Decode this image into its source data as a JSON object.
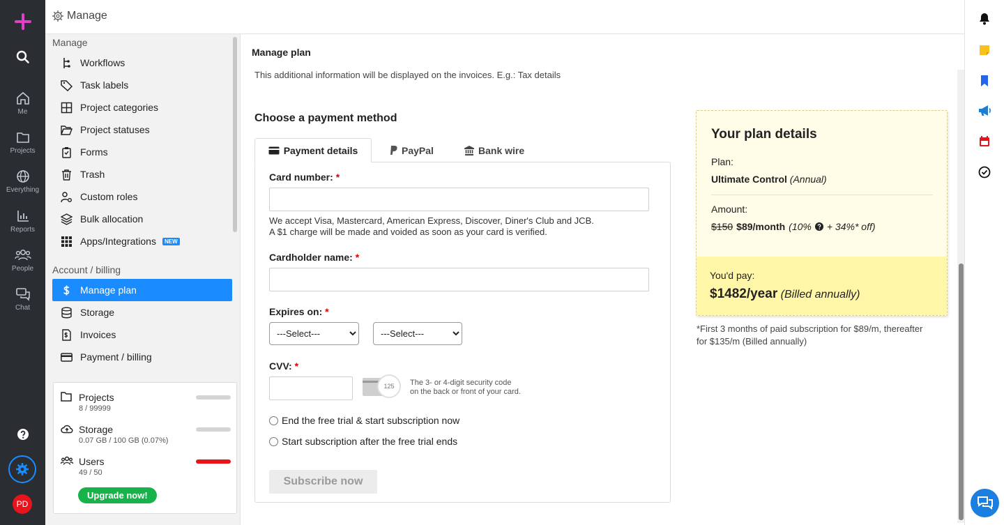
{
  "rail": {
    "items": [
      {
        "label": "Me"
      },
      {
        "label": "Projects"
      },
      {
        "label": "Everything"
      },
      {
        "label": "Reports"
      },
      {
        "label": "People"
      },
      {
        "label": "Chat"
      }
    ],
    "avatar": "PD"
  },
  "topbar": {
    "title": "Manage"
  },
  "sidebar": {
    "section_manage": "Manage",
    "manage_items": [
      {
        "label": "Workflows"
      },
      {
        "label": "Task labels"
      },
      {
        "label": "Project categories"
      },
      {
        "label": "Project statuses"
      },
      {
        "label": "Forms"
      },
      {
        "label": "Trash"
      },
      {
        "label": "Custom roles"
      },
      {
        "label": "Bulk allocation"
      },
      {
        "label": "Apps/Integrations",
        "badge": "NEW"
      }
    ],
    "section_account": "Account / billing",
    "account_items": [
      {
        "label": "Manage plan"
      },
      {
        "label": "Storage"
      },
      {
        "label": "Invoices"
      },
      {
        "label": "Payment / billing"
      }
    ],
    "usage": {
      "projects": {
        "label": "Projects",
        "value": "8 / 99999"
      },
      "storage": {
        "label": "Storage",
        "value": "0.07 GB / 100 GB (0.07%)"
      },
      "users": {
        "label": "Users",
        "value": "49 / 50"
      },
      "upgrade": "Upgrade now!"
    }
  },
  "main": {
    "title": "Manage plan",
    "info": "This additional information will be displayed on the invoices. E.g.: Tax details",
    "payment_heading": "Choose a payment method",
    "tabs": [
      {
        "label": "Payment details"
      },
      {
        "label": "PayPal"
      },
      {
        "label": "Bank wire"
      }
    ],
    "card_number_label": "Card number:",
    "card_note_1": "We accept Visa, Mastercard, American Express, Discover, Diner's Club and JCB.",
    "card_note_2": "A $1 charge will be made and voided as soon as your card is verified.",
    "cardholder_label": "Cardholder name:",
    "expires_label": "Expires on:",
    "select_placeholder": "---Select---",
    "cvv_label": "CVV:",
    "cvv_card_number": "125",
    "cvv_hint_1": "The 3- or 4-digit security code",
    "cvv_hint_2": "on the back or front of your card.",
    "radio_now": "End the free trial & start subscription now",
    "radio_after": "Start subscription after the free trial ends",
    "subscribe": "Subscribe now",
    "required_mark": "*"
  },
  "plan": {
    "heading": "Your plan details",
    "plan_label": "Plan:",
    "plan_name": "Ultimate Control",
    "plan_period": "(Annual)",
    "amount_label": "Amount:",
    "old_price": "$150",
    "new_price": "$89/month",
    "discount_a": "(10%",
    "discount_b": "+ 34%* off)",
    "pay_label": "You'd pay:",
    "pay_amount": "$1482/year",
    "pay_billing": "(Billed annually)",
    "footnote_1": "*First 3 months of paid subscription for $89/m, thereafter",
    "footnote_2": "for $135/m (Billed annually)"
  },
  "colors": {
    "accent": "#1a8cff",
    "rail": "#2a2d32",
    "plan_bg": "#fffce8",
    "plan_pay_bg": "#fff6a8",
    "upgrade": "#17b34a",
    "users_bar": "#e8131b"
  }
}
